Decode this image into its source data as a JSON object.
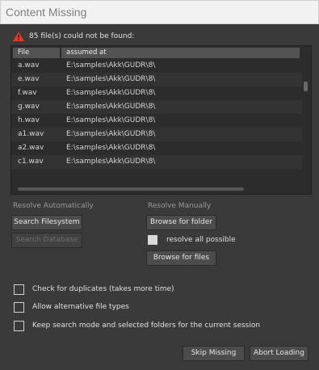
{
  "window": {
    "title": "Content Missing"
  },
  "warning": {
    "icon": "warning-triangle-icon",
    "text": "85 file(s) could not be found:"
  },
  "table": {
    "columns": [
      "File",
      "assumed at"
    ],
    "rows": [
      [
        "a.wav",
        "E:\\samples\\Akk\\GUDR\\8\\"
      ],
      [
        "e.wav",
        "E:\\samples\\Akk\\GUDR\\8\\"
      ],
      [
        "f.wav",
        "E:\\samples\\Akk\\GUDR\\8\\"
      ],
      [
        "g.wav",
        "E:\\samples\\Akk\\GUDR\\8\\"
      ],
      [
        "h.wav",
        "E:\\samples\\Akk\\GUDR\\8\\"
      ],
      [
        "a1.wav",
        "E:\\samples\\Akk\\GUDR\\8\\"
      ],
      [
        "a2.wav",
        "E:\\samples\\Akk\\GUDR\\8\\"
      ],
      [
        "c1.wav",
        "E:\\samples\\Akk\\GUDR\\8\\"
      ]
    ]
  },
  "resolve_auto": {
    "label": "Resolve Automatically",
    "search_filesystem": "Search Filesystem",
    "search_database": "Search Database"
  },
  "resolve_manual": {
    "label": "Resolve Manually",
    "browse_folder": "Browse for folder",
    "resolve_all": "resolve all possible",
    "browse_files": "Browse for files"
  },
  "options": {
    "duplicates": "Check for duplicates (takes more time)",
    "alt_types": "Allow alternative file types",
    "keep_mode": "Keep search mode and selected folders for the current session"
  },
  "footer": {
    "skip": "Skip Missing",
    "abort": "Abort Loading"
  },
  "colors": {
    "background": "#3a3a3a",
    "warning": "#e03a2f"
  }
}
